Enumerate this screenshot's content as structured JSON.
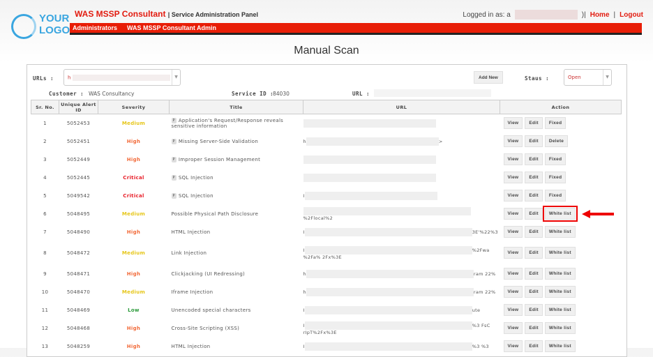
{
  "logo": {
    "line1": "YOUR",
    "line2": "LOGO"
  },
  "header": {
    "brand": "WAS MSSP Consultant",
    "subtitle": "| Service Administration Panel",
    "logged_in_label": "Logged in as: a",
    "logged_in_suffix": ")|",
    "home": "Home",
    "sep": "|",
    "logout": "Logout"
  },
  "nav": [
    "Administrators",
    "WAS MSSP Consultant Admin"
  ],
  "page_title": "Manual Scan",
  "filters": {
    "urls_label": "URLs :",
    "urls_value": "h",
    "add_new": "Add New",
    "status_label": "Staus :",
    "status_value": "Open",
    "customer_label": "Customer :",
    "customer_value": "WAS Consultancy",
    "service_label": "Service ID :",
    "service_value": "84030",
    "url_label": "URL :"
  },
  "colors": {
    "Medium": "#e6c619",
    "High": "#f26b3a",
    "Critical": "#e8202a",
    "Low": "#2a9a3a",
    "accent": "#e81e07"
  },
  "table": {
    "headers": [
      "Sr. No.",
      "Unique Alert ID",
      "Severity",
      "Title",
      "URL",
      "Action"
    ],
    "rows": [
      {
        "sr": "1",
        "id": "5052453",
        "severity": "Medium",
        "p": true,
        "title": "Application's Request/Response reveals sensitive information",
        "url_pre": "",
        "url_post": "",
        "actions": [
          "View",
          "Edit",
          "Fixed"
        ]
      },
      {
        "sr": "2",
        "id": "5052451",
        "severity": "High",
        "p": true,
        "title": "Missing Server-Side Validation",
        "url_pre": "h",
        "url_post": ">",
        "actions": [
          "View",
          "Edit",
          "Delete"
        ]
      },
      {
        "sr": "3",
        "id": "5052449",
        "severity": "High",
        "p": true,
        "title": "Improper Session Management",
        "url_pre": "",
        "url_post": "",
        "actions": [
          "View",
          "Edit",
          "Fixed"
        ]
      },
      {
        "sr": "4",
        "id": "5052445",
        "severity": "Critical",
        "p": true,
        "title": "SQL Injection",
        "url_pre": "",
        "url_post": "",
        "actions": [
          "View",
          "Edit",
          "Fixed"
        ]
      },
      {
        "sr": "5",
        "id": "5049542",
        "severity": "Critical",
        "p": true,
        "title": "SQL Injection",
        "url_pre": "I",
        "url_post": "",
        "actions": [
          "View",
          "Edit",
          "Fixed"
        ]
      },
      {
        "sr": "6",
        "id": "5048495",
        "severity": "Medium",
        "p": false,
        "title": "Possible Physical Path Disclosure",
        "url_pre": "",
        "url_post": "%2Flocal%2",
        "actions": [
          "View",
          "Edit",
          "White list"
        ]
      },
      {
        "sr": "7",
        "id": "5048490",
        "severity": "High",
        "p": false,
        "title": "HTML Injection",
        "url_pre": "I",
        "url_post": "3E'%22%3",
        "actions": [
          "View",
          "Edit",
          "White list"
        ]
      },
      {
        "sr": "8",
        "id": "5048472",
        "severity": "Medium",
        "p": false,
        "title": "Link Injection",
        "url_pre": "I",
        "url_post": "%2Fwa %2Fa% 2Fx%3E",
        "actions": [
          "View",
          "Edit",
          "White list"
        ]
      },
      {
        "sr": "9",
        "id": "5048471",
        "severity": "High",
        "p": false,
        "title": "Clickjacking (UI Redressing)",
        "url_pre": "h",
        "url_post": "ram 22%",
        "actions": [
          "View",
          "Edit",
          "White list"
        ]
      },
      {
        "sr": "10",
        "id": "5048470",
        "severity": "Medium",
        "p": false,
        "title": "Iframe Injection",
        "url_pre": "h",
        "url_post": "ram 22%",
        "actions": [
          "View",
          "Edit",
          "White list"
        ]
      },
      {
        "sr": "11",
        "id": "5048469",
        "severity": "Low",
        "p": false,
        "title": "Unencoded special characters",
        "url_pre": "I",
        "url_post": "ute",
        "actions": [
          "View",
          "Edit",
          "White list"
        ]
      },
      {
        "sr": "12",
        "id": "5048468",
        "severity": "High",
        "p": false,
        "title": "Cross-Site Scripting (XSS)",
        "url_pre": "I",
        "url_post": "%3 FsC rIpT%2Fx%3E",
        "actions": [
          "View",
          "Edit",
          "White list"
        ]
      },
      {
        "sr": "13",
        "id": "5048259",
        "severity": "High",
        "p": false,
        "title": "HTML Injection",
        "url_pre": "I",
        "url_post": "%3 %3",
        "actions": [
          "View",
          "Edit",
          "White list"
        ]
      }
    ]
  }
}
